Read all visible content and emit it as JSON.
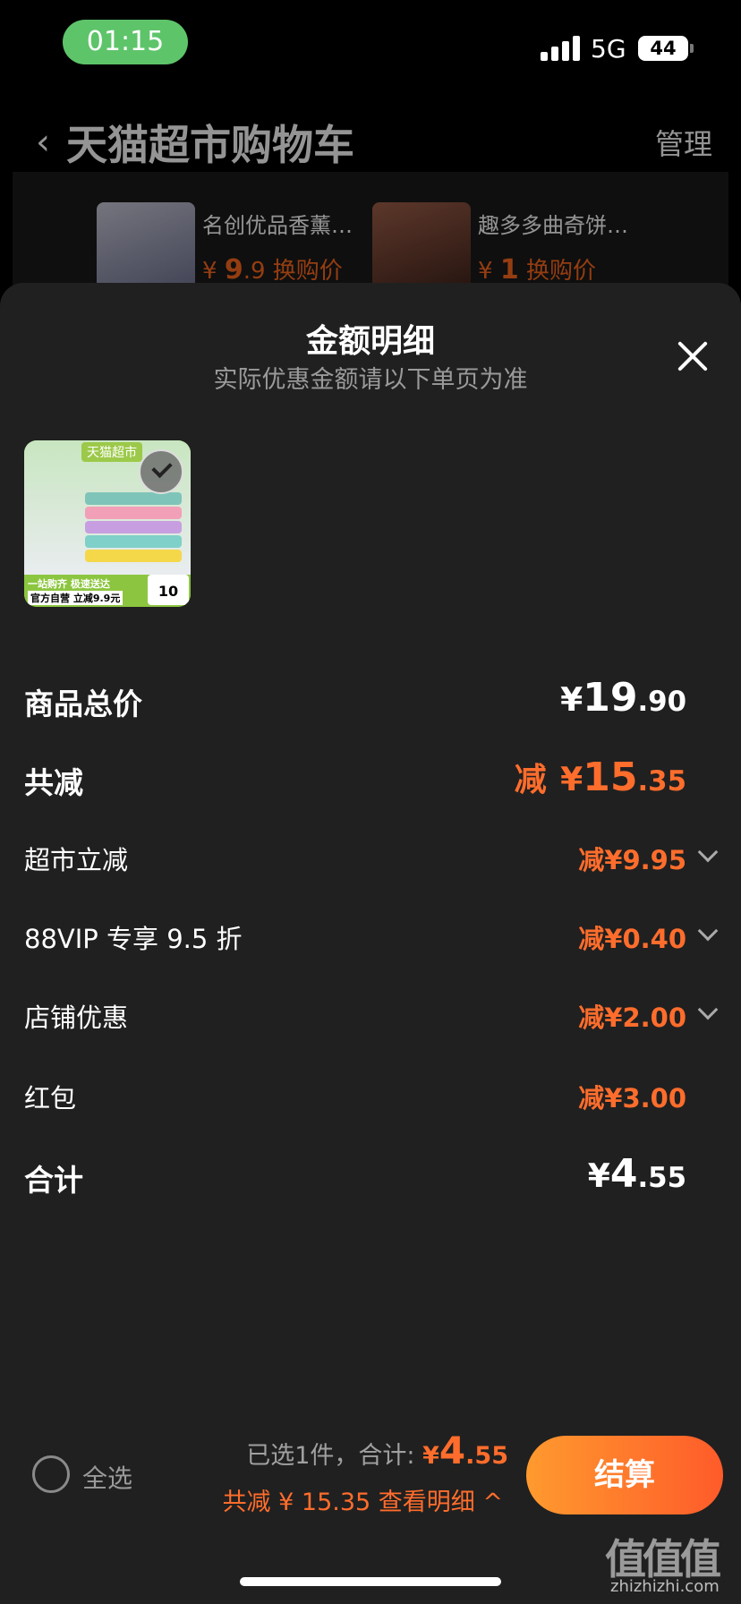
{
  "status": {
    "time": "01:15",
    "network": "5G",
    "battery": "44"
  },
  "cart": {
    "title": "天猫超市购物车",
    "manage": "管理",
    "products": [
      {
        "name": "名创优品香薰…",
        "price_symbol": "¥",
        "price_int": "9",
        "price_dec": ".9",
        "tag": "换购价"
      },
      {
        "name": "趣多多曲奇饼…",
        "price_symbol": "¥",
        "price_int": "1",
        "price_dec": "",
        "tag": "换购价"
      }
    ]
  },
  "sheet": {
    "title": "金额明细",
    "subtitle": "实际优惠金额请以下单页为准",
    "thumb": {
      "brand": "天猫超市",
      "band1": "一站购齐 极速送达",
      "band2": "官方自营 立减9.9元",
      "price": "10"
    },
    "rows": {
      "total_price": {
        "label": "商品总价",
        "symbol": "¥",
        "int": "19",
        "dec": ".90"
      },
      "total_discount": {
        "label": "共减",
        "prefix": "减",
        "symbol": "¥",
        "int": "15",
        "dec": ".35"
      },
      "market_discount": {
        "label": "超市立减",
        "value": "减¥9.95"
      },
      "vip_discount": {
        "label": "88VIP 专享 9.5 折",
        "value": "减¥0.40"
      },
      "store_discount": {
        "label": "店铺优惠",
        "value": "减¥2.00"
      },
      "red_packet": {
        "label": "红包",
        "value": "减¥3.00"
      },
      "grand_total": {
        "label": "合计",
        "symbol": "¥",
        "int": "4",
        "dec": ".55"
      }
    }
  },
  "bottom": {
    "select_all": "全选",
    "selected_text": "已选1件，合计:",
    "total_symbol": "¥",
    "total_int": "4",
    "total_dec": ".55",
    "discount_text": "共减 ¥ 15.35 查看明细 ^",
    "checkout": "结算"
  },
  "watermark": {
    "main": "值值值",
    "sub": "zhizhizhi.com"
  },
  "colors": {
    "accent": "#ff6d2c",
    "sheet_bg": "#202020",
    "time_pill": "#5ec46a"
  }
}
